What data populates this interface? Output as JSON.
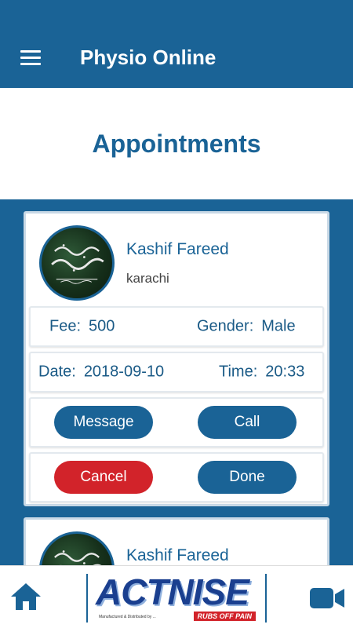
{
  "app": {
    "title": "Physio Online"
  },
  "page": {
    "title": "Appointments"
  },
  "appointments": [
    {
      "name": "Kashif Fareed",
      "city": "karachi",
      "fee_label": "Fee:",
      "fee": "500",
      "gender_label": "Gender:",
      "gender": "Male",
      "date_label": "Date:",
      "date": "2018-09-10",
      "time_label": "Time:",
      "time": "20:33",
      "message_label": "Message",
      "call_label": "Call",
      "cancel_label": "Cancel",
      "done_label": "Done"
    },
    {
      "name": "Kashif Fareed"
    }
  ],
  "bottom_bar": {
    "logo_text": "ACTNISE",
    "logo_tagline": "RUBS OFF PAIN",
    "logo_subtext": "Manufactured & Distributed by ...",
    "icons": [
      "home-icon",
      "video-camera-icon"
    ]
  },
  "colors": {
    "primary": "#1a6396",
    "danger": "#d2232a",
    "background": "#ffffff"
  }
}
